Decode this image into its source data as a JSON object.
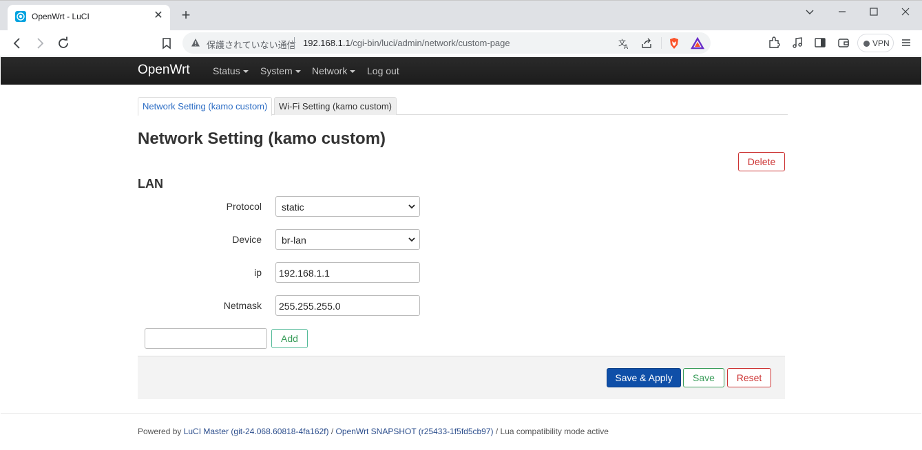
{
  "browser": {
    "tab_title": "OpenWrt - LuCI",
    "omnibox": {
      "security_text": "保護されていない通信",
      "url_host": "192.168.1.1",
      "url_path": "/cgi-bin/luci/admin/network/custom-page"
    },
    "vpn_label": "VPN",
    "icons": [
      "back-icon",
      "forward-icon",
      "reload-icon",
      "bookmark-icon",
      "warning-icon",
      "translate-icon",
      "share-icon",
      "brave-shields-icon",
      "brave-rewards-icon",
      "extensions-icon",
      "media-icon",
      "sidebar-icon",
      "wallet-icon",
      "menu-icon"
    ]
  },
  "luci": {
    "brand": "OpenWrt",
    "menu": [
      {
        "label": "Status",
        "dropdown": true
      },
      {
        "label": "System",
        "dropdown": true
      },
      {
        "label": "Network",
        "dropdown": true
      },
      {
        "label": "Log out",
        "dropdown": false
      }
    ]
  },
  "page": {
    "tabs": [
      {
        "label": "Network Setting (kamo custom)",
        "active": true
      },
      {
        "label": "Wi-Fi Setting (kamo custom)",
        "active": false
      }
    ],
    "title": "Network Setting (kamo custom)",
    "delete_label": "Delete",
    "section_title": "LAN",
    "fields": {
      "protocol": {
        "label": "Protocol",
        "value": "static"
      },
      "device": {
        "label": "Device",
        "value": "br-lan"
      },
      "ip": {
        "label": "ip",
        "value": "192.168.1.1"
      },
      "netmask": {
        "label": "Netmask",
        "value": "255.255.255.0"
      }
    },
    "new_section_value": "",
    "add_label": "Add",
    "actions": {
      "save_apply": "Save & Apply",
      "save": "Save",
      "reset": "Reset"
    }
  },
  "footer": {
    "powered_by": "Powered by ",
    "luci_link": "LuCI Master (git-24.068.60818-4fa162f)",
    "sep1": " / ",
    "openwrt_link": "OpenWrt SNAPSHOT (r25433-1f5fd5cb97)",
    "suffix": " / Lua compatibility mode active"
  },
  "colors": {
    "header_bg": "#222222",
    "link": "#2b6cc4",
    "primary": "#0f4fa8",
    "positive": "#3a9d5a",
    "negative": "#cc3333"
  }
}
